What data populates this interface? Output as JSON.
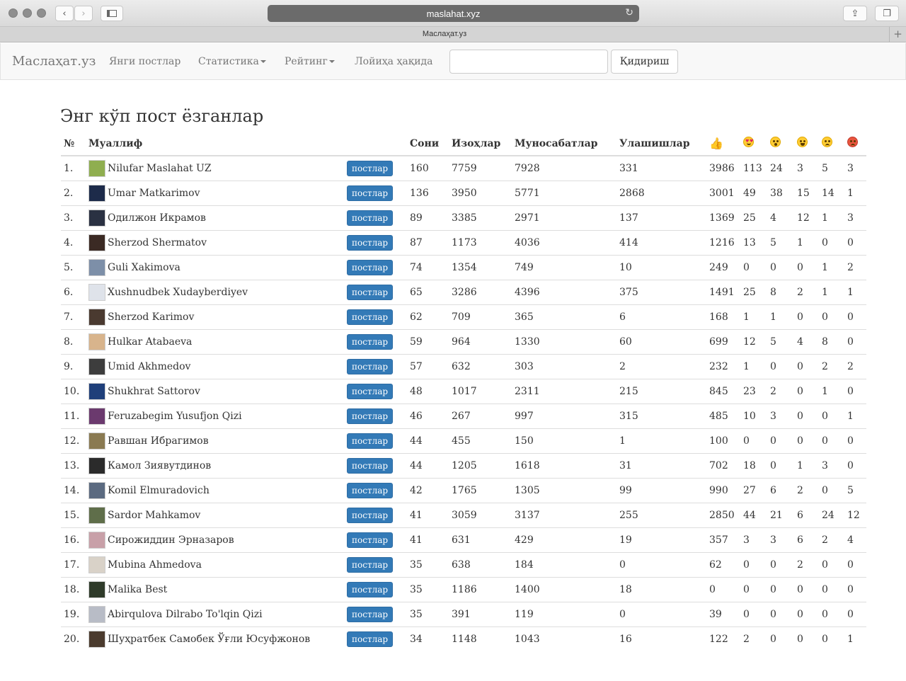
{
  "browser": {
    "url": "maslahat.xyz",
    "tab_title": "Маслаҳат.уз",
    "new_tab_symbol": "+"
  },
  "navbar": {
    "brand": "Маслаҳат.уз",
    "links": [
      {
        "label": "Янги постлар"
      },
      {
        "label": "Статистика"
      },
      {
        "label": "Рейтинг"
      },
      {
        "label": "Лойиҳа ҳақида"
      }
    ],
    "search_value": "",
    "search_button": "Қидириш"
  },
  "page": {
    "title": "Энг кўп пост ёзганлар"
  },
  "table": {
    "headers": {
      "num": "№",
      "author": "Муаллиф",
      "count": "Сони",
      "comments": "Изоҳлар",
      "reactions": "Муносабатлар",
      "shares": "Улашишлар"
    },
    "reaction_icons": [
      "thumbs-up-icon",
      "heart-eyes-icon",
      "surprised-icon",
      "laughing-icon",
      "sad-icon",
      "angry-icon"
    ],
    "posts_label": "постлар",
    "rows": [
      {
        "num": "1.",
        "name": "Nilufar Maslahat UZ",
        "count": "160",
        "comments": "7759",
        "reactions": "7928",
        "shares": "331",
        "like": "3986",
        "love": "113",
        "wow": "24",
        "haha": "3",
        "sad": "5",
        "angry": "3",
        "avatar": "#8fae4f"
      },
      {
        "num": "2.",
        "name": "Umar Matkarimov",
        "count": "136",
        "comments": "3950",
        "reactions": "5771",
        "shares": "2868",
        "like": "3001",
        "love": "49",
        "wow": "38",
        "haha": "15",
        "sad": "14",
        "angry": "1",
        "avatar": "#1d2b4a"
      },
      {
        "num": "3.",
        "name": "Одилжон Икрамов",
        "count": "89",
        "comments": "3385",
        "reactions": "2971",
        "shares": "137",
        "like": "1369",
        "love": "25",
        "wow": "4",
        "haha": "12",
        "sad": "1",
        "angry": "3",
        "avatar": "#2a3142"
      },
      {
        "num": "4.",
        "name": "Sherzod Shermatov",
        "count": "87",
        "comments": "1173",
        "reactions": "4036",
        "shares": "414",
        "like": "1216",
        "love": "13",
        "wow": "5",
        "haha": "1",
        "sad": "0",
        "angry": "0",
        "avatar": "#3b2a24"
      },
      {
        "num": "5.",
        "name": "Guli Xakimova",
        "count": "74",
        "comments": "1354",
        "reactions": "749",
        "shares": "10",
        "like": "249",
        "love": "0",
        "wow": "0",
        "haha": "0",
        "sad": "1",
        "angry": "2",
        "avatar": "#7d8fa8"
      },
      {
        "num": "6.",
        "name": "Xushnudbek Xudayberdiyev",
        "count": "65",
        "comments": "3286",
        "reactions": "4396",
        "shares": "375",
        "like": "1491",
        "love": "25",
        "wow": "8",
        "haha": "2",
        "sad": "1",
        "angry": "1",
        "avatar": "#dfe3ea"
      },
      {
        "num": "7.",
        "name": "Sherzod Karimov",
        "count": "62",
        "comments": "709",
        "reactions": "365",
        "shares": "6",
        "like": "168",
        "love": "1",
        "wow": "1",
        "haha": "0",
        "sad": "0",
        "angry": "0",
        "avatar": "#4a3a30"
      },
      {
        "num": "8.",
        "name": "Hulkar Atabaeva",
        "count": "59",
        "comments": "964",
        "reactions": "1330",
        "shares": "60",
        "like": "699",
        "love": "12",
        "wow": "5",
        "haha": "4",
        "sad": "8",
        "angry": "0",
        "avatar": "#d8b48c"
      },
      {
        "num": "9.",
        "name": "Umid Akhmedov",
        "count": "57",
        "comments": "632",
        "reactions": "303",
        "shares": "2",
        "like": "232",
        "love": "1",
        "wow": "0",
        "haha": "0",
        "sad": "2",
        "angry": "2",
        "avatar": "#3d3d3d"
      },
      {
        "num": "10.",
        "name": "Shukhrat Sattorov",
        "count": "48",
        "comments": "1017",
        "reactions": "2311",
        "shares": "215",
        "like": "845",
        "love": "23",
        "wow": "2",
        "haha": "0",
        "sad": "1",
        "angry": "0",
        "avatar": "#1f3f7a"
      },
      {
        "num": "11.",
        "name": "Feruzabegim Yusufjon Qizi",
        "count": "46",
        "comments": "267",
        "reactions": "997",
        "shares": "315",
        "like": "485",
        "love": "10",
        "wow": "3",
        "haha": "0",
        "sad": "0",
        "angry": "1",
        "avatar": "#6b3a6e"
      },
      {
        "num": "12.",
        "name": "Равшан Ибрагимов",
        "count": "44",
        "comments": "455",
        "reactions": "150",
        "shares": "1",
        "like": "100",
        "love": "0",
        "wow": "0",
        "haha": "0",
        "sad": "0",
        "angry": "0",
        "avatar": "#8a7a52"
      },
      {
        "num": "13.",
        "name": "Камол Зиявутдинов",
        "count": "44",
        "comments": "1205",
        "reactions": "1618",
        "shares": "31",
        "like": "702",
        "love": "18",
        "wow": "0",
        "haha": "1",
        "sad": "3",
        "angry": "0",
        "avatar": "#2b2b2b"
      },
      {
        "num": "14.",
        "name": "Komil Elmuradovich",
        "count": "42",
        "comments": "1765",
        "reactions": "1305",
        "shares": "99",
        "like": "990",
        "love": "27",
        "wow": "6",
        "haha": "2",
        "sad": "0",
        "angry": "5",
        "avatar": "#5b6a80"
      },
      {
        "num": "15.",
        "name": "Sardor Mahkamov",
        "count": "41",
        "comments": "3059",
        "reactions": "3137",
        "shares": "255",
        "like": "2850",
        "love": "44",
        "wow": "21",
        "haha": "6",
        "sad": "24",
        "angry": "12",
        "avatar": "#5f6e4a"
      },
      {
        "num": "16.",
        "name": "Сирожиддин Эрназаров",
        "count": "41",
        "comments": "631",
        "reactions": "429",
        "shares": "19",
        "like": "357",
        "love": "3",
        "wow": "3",
        "haha": "6",
        "sad": "2",
        "angry": "4",
        "avatar": "#c8a0a8"
      },
      {
        "num": "17.",
        "name": "Mubina Ahmedova",
        "count": "35",
        "comments": "638",
        "reactions": "184",
        "shares": "0",
        "like": "62",
        "love": "0",
        "wow": "0",
        "haha": "2",
        "sad": "0",
        "angry": "0",
        "avatar": "#d9d2c8"
      },
      {
        "num": "18.",
        "name": "Malika Best",
        "count": "35",
        "comments": "1186",
        "reactions": "1400",
        "shares": "18",
        "like": "0",
        "love": "0",
        "wow": "0",
        "haha": "0",
        "sad": "0",
        "angry": "0",
        "avatar": "#2f3b2a"
      },
      {
        "num": "19.",
        "name": "Abirqulova Dilrabo To'lqin Qizi",
        "count": "35",
        "comments": "391",
        "reactions": "119",
        "shares": "0",
        "like": "39",
        "love": "0",
        "wow": "0",
        "haha": "0",
        "sad": "0",
        "angry": "0",
        "avatar": "#b8bcc6"
      },
      {
        "num": "20.",
        "name": "Шуҳратбек Самобек Ўғли Юсуфжонов",
        "count": "34",
        "comments": "1148",
        "reactions": "1043",
        "shares": "16",
        "like": "122",
        "love": "2",
        "wow": "0",
        "haha": "0",
        "sad": "0",
        "angry": "1",
        "avatar": "#4b3b2e"
      }
    ]
  }
}
